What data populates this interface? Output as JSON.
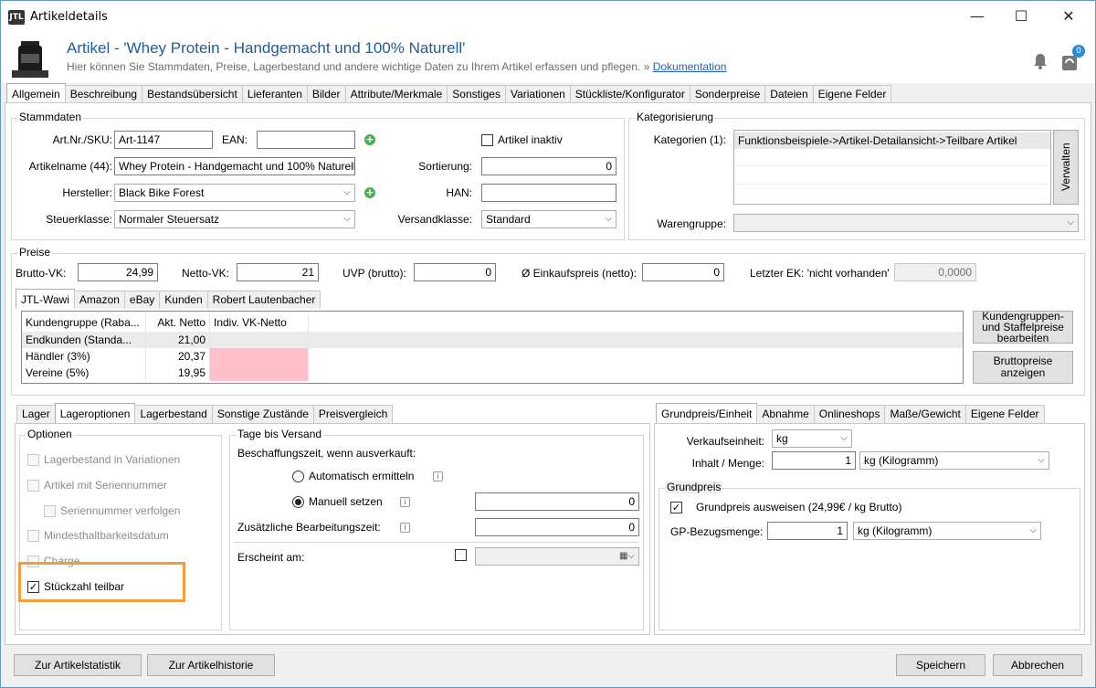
{
  "window": {
    "title": "Artikeldetails",
    "logo_text": "JTL",
    "minimize": "—",
    "maximize": "☐",
    "close": "✕"
  },
  "header": {
    "title": "Artikel - 'Whey Protein - Handgemacht und 100% Naturell'",
    "subtitle": "Hier können Sie Stammdaten, Preise, Lagerbestand und andere wichtige Daten zu Ihrem Artikel erfassen und pflegen. » ",
    "doc_link": "Dokumentation",
    "notification_count": "0"
  },
  "main_tabs": [
    "Allgemein",
    "Beschreibung",
    "Bestandsübersicht",
    "Lieferanten",
    "Bilder",
    "Attribute/Merkmale",
    "Sonstiges",
    "Variationen",
    "Stückliste/Konfigurator",
    "Sonderpreise",
    "Dateien",
    "Eigene Felder"
  ],
  "stammdaten": {
    "title": "Stammdaten",
    "artnr_label": "Art.Nr./SKU:",
    "artnr_value": "Art-1147",
    "ean_label": "EAN:",
    "ean_value": "",
    "inactive_label": "Artikel inaktiv",
    "name_label": "Artikelname (44):",
    "name_value": "Whey Protein - Handgemacht und 100% Naturell",
    "sort_label": "Sortierung:",
    "sort_value": "0",
    "hersteller_label": "Hersteller:",
    "hersteller_value": "Black Bike Forest",
    "han_label": "HAN:",
    "han_value": "",
    "steuer_label": "Steuerklasse:",
    "steuer_value": "Normaler Steuersatz",
    "versand_label": "Versandklasse:",
    "versand_value": "Standard"
  },
  "kategorisierung": {
    "title": "Kategorisierung",
    "kat_label": "Kategorien (1):",
    "kat_value": "Funktionsbeispiele->Artikel-Detailansicht->Teilbare Artikel",
    "verwalten": "Verwalten",
    "warengruppe_label": "Warengruppe:",
    "warengruppe_value": ""
  },
  "preise": {
    "title": "Preise",
    "brutto_label": "Brutto-VK:",
    "brutto_value": "24,99",
    "netto_label": "Netto-VK:",
    "netto_value": "21",
    "uvp_label": "UVP (brutto):",
    "uvp_value": "0",
    "ek_label": "Ø Einkaufspreis (netto):",
    "ek_value": "0",
    "letzter_label": "Letzter EK: 'nicht vorhanden'",
    "letzter_value": "0,0000",
    "tabs": [
      "JTL-Wawi",
      "Amazon",
      "eBay",
      "Kunden",
      "Robert Lautenbacher"
    ],
    "columns": [
      "Kundengruppe (Raba...",
      "Akt. Netto",
      "Indiv. VK-Netto"
    ],
    "rows": [
      {
        "group": "Endkunden (Standa...",
        "netto": "21,00",
        "indiv": ""
      },
      {
        "group": "Händler (3%)",
        "netto": "20,37",
        "indiv": ""
      },
      {
        "group": "Vereine (5%)",
        "netto": "19,95",
        "indiv": ""
      }
    ],
    "btn_staffel": "Kundengruppen- und Staffelpreise bearbeiten",
    "btn_brutto": "Bruttopreise anzeigen"
  },
  "lager_tabs": [
    "Lager",
    "Lageroptionen",
    "Lagerbestand",
    "Sonstige Zustände",
    "Preisvergleich"
  ],
  "optionen": {
    "title": "Optionen",
    "items": [
      "Lagerbestand in Variationen",
      "Artikel mit Seriennummer",
      "Seriennummer verfolgen",
      "Mindesthaltbarkeitsdatum",
      "Charge",
      "Stückzahl teilbar"
    ],
    "checkmark": "✓"
  },
  "versand": {
    "title": "Tage bis Versand",
    "beschaffung_label": "Beschaffungszeit, wenn ausverkauft:",
    "auto_label": "Automatisch ermitteln",
    "manuell_label": "Manuell setzen",
    "manuell_value": "0",
    "zusatz_label": "Zusätzliche Bearbeitungszeit:",
    "zusatz_value": "0",
    "erscheint_label": "Erscheint am:"
  },
  "grund_tabs": [
    "Grundpreis/Einheit",
    "Abnahme",
    "Onlineshops",
    "Maße/Gewicht",
    "Eigene Felder"
  ],
  "grundpreis": {
    "vk_einheit_label": "Verkaufseinheit:",
    "vk_einheit_value": "kg",
    "inhalt_label": "Inhalt / Menge:",
    "inhalt_value": "1",
    "inhalt_unit": "kg (Kilogramm)",
    "title": "Grundpreis",
    "ausweisen_label": "Grundpreis ausweisen (24,99€ / kg Brutto)",
    "bezug_label": "GP-Bezugsmenge:",
    "bezug_value": "1",
    "bezug_unit": "kg (Kilogramm)"
  },
  "footer": {
    "statistik": "Zur Artikelstatistik",
    "historie": "Zur Artikelhistorie",
    "speichern": "Speichern",
    "abbrechen": "Abbrechen"
  }
}
